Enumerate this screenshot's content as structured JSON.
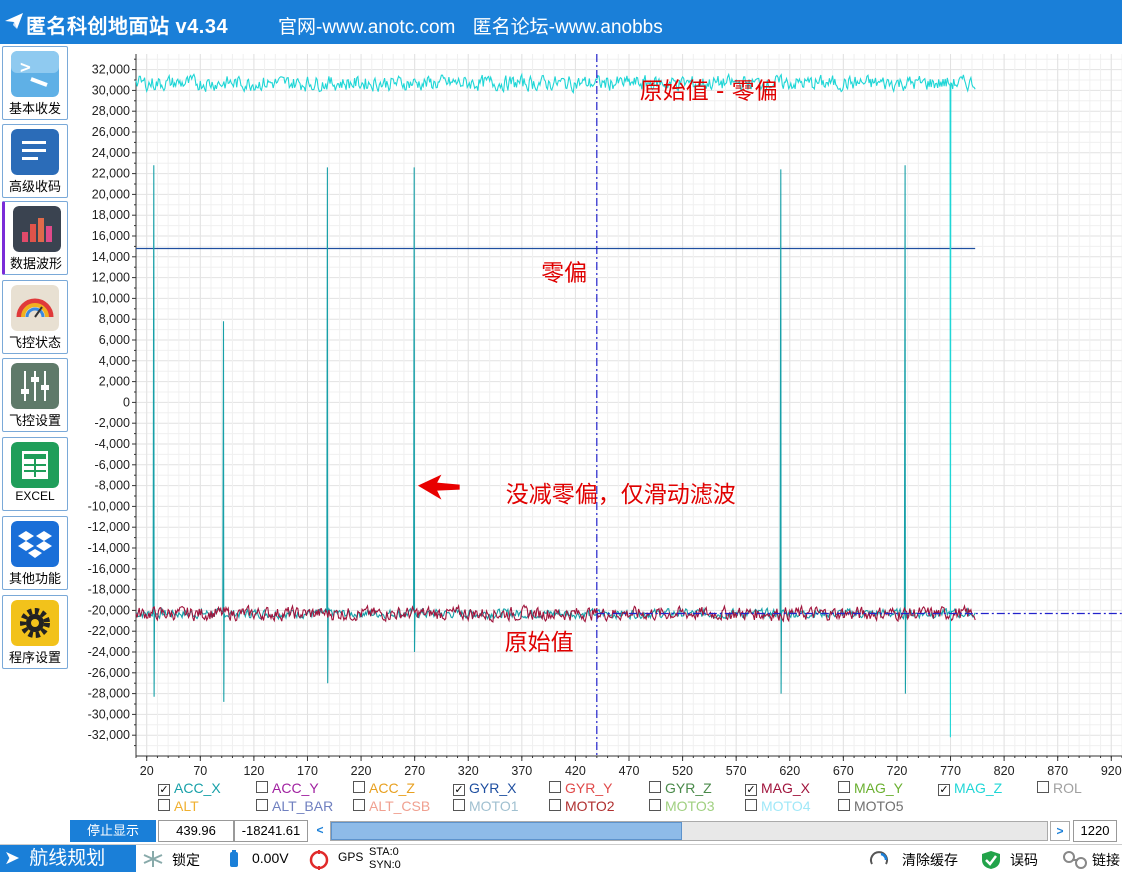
{
  "window": {
    "app_title": "匿名科创地面站 v4.34",
    "link_official": "官网-www.anotc.com",
    "link_forum": "匿名论坛-www.anobbs"
  },
  "sidebar": {
    "items": [
      {
        "label": "基本收发",
        "icon": "terminal-icon",
        "color": "#4aa3df"
      },
      {
        "label": "高级收码",
        "icon": "document-lines-icon",
        "color": "#2b6cb8"
      },
      {
        "label": "数据波形",
        "icon": "bar-chart-icon",
        "color": "#3a4350"
      },
      {
        "label": "飞控状态",
        "icon": "gauge-icon",
        "color": "#e8e0d2"
      },
      {
        "label": "飞控设置",
        "icon": "sliders-icon",
        "color": "#5f7a6a"
      },
      {
        "label": "EXCEL",
        "icon": "spreadsheet-icon",
        "color": "#1f9e5a"
      },
      {
        "label": "其他功能",
        "icon": "dropbox-icon",
        "color": "#1a6fd8"
      },
      {
        "label": "程序设置",
        "icon": "gear-icon",
        "color": "#f2c21b"
      }
    ]
  },
  "chart_data": {
    "type": "line",
    "xlim": [
      10,
      930
    ],
    "ylim": [
      -34000,
      33500
    ],
    "x_ticks": [
      20,
      70,
      120,
      170,
      220,
      270,
      320,
      370,
      420,
      470,
      520,
      570,
      620,
      670,
      720,
      770,
      820,
      870,
      920
    ],
    "x_tick_labels": [
      "20",
      "70",
      "120",
      "170",
      "220",
      "270",
      "320",
      "370",
      "420",
      "470",
      "520",
      "570",
      "620",
      "670",
      "720",
      "770",
      "820",
      "870",
      "920"
    ],
    "y_ticks": [
      32000,
      30000,
      28000,
      26000,
      24000,
      22000,
      20000,
      18000,
      16000,
      14000,
      12000,
      10000,
      8000,
      6000,
      4000,
      2000,
      0,
      -2000,
      -4000,
      -6000,
      -8000,
      -10000,
      -12000,
      -14000,
      -16000,
      -18000,
      -20000,
      -22000,
      -24000,
      -26000,
      -28000,
      -30000,
      -32000
    ],
    "y_tick_labels": [
      "32,000",
      "30,000",
      "28,000",
      "26,000",
      "24,000",
      "22,000",
      "20,000",
      "18,000",
      "16,000",
      "14,000",
      "12,000",
      "10,000",
      "8,000",
      "6,000",
      "4,000",
      "2,000",
      "0",
      "-2,000",
      "-4,000",
      "-6,000",
      "-8,000",
      "-10,000",
      "-12,000",
      "-14,000",
      "-16,000",
      "-18,000",
      "-20,000",
      "-22,000",
      "-24,000",
      "-26,000",
      "-28,000",
      "-30,000",
      "-32,000"
    ],
    "grid": true,
    "cursor": {
      "x": 439.96,
      "y": -20300
    },
    "hline": {
      "y": 14800,
      "x_end": 793
    },
    "x_end": 793,
    "series": [
      {
        "name": "GYR_X",
        "color": "#17a0a8",
        "base": -20300,
        "noise": 600,
        "spikes": [
          [
            27,
            22800,
            -28300
          ],
          [
            92,
            7800,
            -28800
          ],
          [
            189,
            22600,
            -27000
          ],
          [
            270,
            22600,
            -24000
          ],
          [
            612,
            22400,
            -28000
          ],
          [
            728,
            22800,
            -28000
          ]
        ]
      },
      {
        "name": "MAG_X",
        "color": "#a0143c",
        "base": -20300,
        "noise": 900,
        "spikes": []
      },
      {
        "name": "MAG_Z",
        "color": "#1fd6d6",
        "base": 30700,
        "noise": 1000,
        "spikes": [
          [
            770,
            30500,
            -32200
          ]
        ]
      }
    ],
    "annotations": [
      {
        "text": "原始值 - 零偏",
        "x": 480,
        "y": 29200,
        "color": "#e00000"
      },
      {
        "text": "零偏",
        "x": 388,
        "y": 11700,
        "color": "#e00000"
      },
      {
        "text": "没减零偏，仅滑动滤波",
        "x": 355,
        "y": -9600,
        "color": "#e00000"
      },
      {
        "text": "原始值",
        "x": 354,
        "y": -23800,
        "color": "#e00000"
      }
    ]
  },
  "legend": {
    "items": [
      {
        "label": "ACC_X",
        "checked": true,
        "color": "#17a0a8"
      },
      {
        "label": "ACC_Y",
        "checked": false,
        "color": "#a020a0"
      },
      {
        "label": "ACC_Z",
        "checked": false,
        "color": "#e8a020"
      },
      {
        "label": "GYR_X",
        "checked": true,
        "color": "#1f4fa0"
      },
      {
        "label": "GYR_Y",
        "checked": false,
        "color": "#e04a4a"
      },
      {
        "label": "GYR_Z",
        "checked": false,
        "color": "#4a8a4a"
      },
      {
        "label": "MAG_X",
        "checked": true,
        "color": "#a0143c"
      },
      {
        "label": "MAG_Y",
        "checked": false,
        "color": "#6ab030"
      },
      {
        "label": "MAG_Z",
        "checked": true,
        "color": "#1fd6d6"
      },
      {
        "label": "ROL",
        "checked": false,
        "color": "#a0a0a0"
      },
      {
        "label": "ALT",
        "checked": false,
        "color": "#f0b030"
      },
      {
        "label": "ALT_BAR",
        "checked": false,
        "color": "#7080c0"
      },
      {
        "label": "ALT_CSB",
        "checked": false,
        "color": "#f0a090"
      },
      {
        "label": "MOTO1",
        "checked": false,
        "color": "#a0c0d0"
      },
      {
        "label": "MOTO2",
        "checked": false,
        "color": "#b03030"
      },
      {
        "label": "MOTO3",
        "checked": false,
        "color": "#a0d080"
      },
      {
        "label": "MOTO4",
        "checked": false,
        "color": "#a0e8f8"
      },
      {
        "label": "MOTO5",
        "checked": false,
        "color": "#707070"
      }
    ]
  },
  "status": {
    "stop_label": "停止显示",
    "cursor_x": "439.96",
    "cursor_y": "-18241.61",
    "left_arrow": "<",
    "right_arrow": ">",
    "width_value": "1220",
    "scroll_thumb_fraction": 0.49
  },
  "bottom": {
    "route_label": "航线规划",
    "lock_label": "锁定",
    "voltage": "0.00V",
    "gps_label": "GPS",
    "sta": "STA:0",
    "syn": "SYN:0",
    "clear_cache": "清除缓存",
    "error_code": "误码",
    "connect": "链接"
  }
}
